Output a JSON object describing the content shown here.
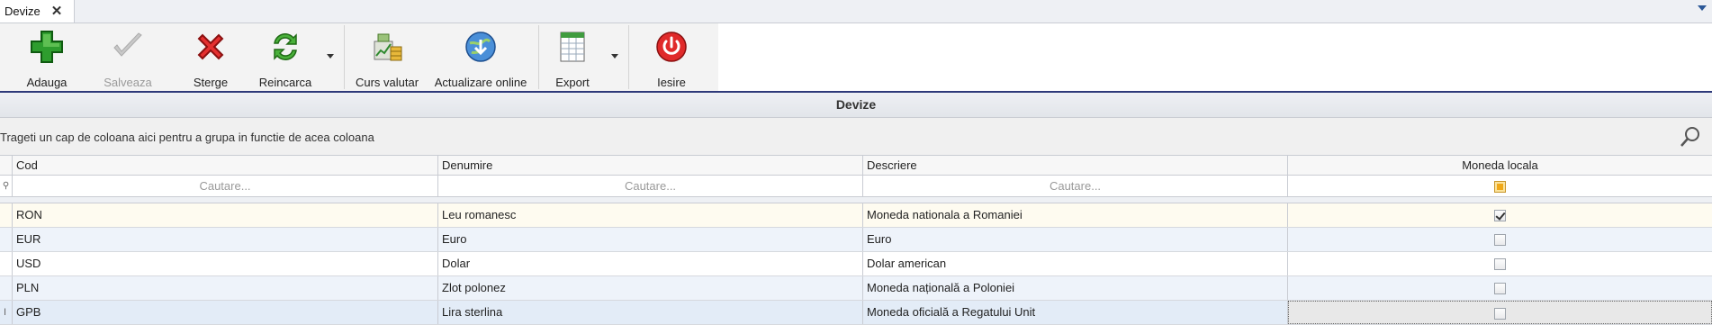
{
  "tab": {
    "title": "Devize",
    "close": "✕"
  },
  "toolbar": {
    "add": "Adauga",
    "save": "Salveaza",
    "delete": "Sterge",
    "reload": "Reincarca",
    "exchange": "Curs valutar",
    "online": "Actualizare online",
    "export": "Export",
    "exit": "Iesire"
  },
  "group_title": "Devize",
  "group_panel_text": "Trageti un cap de coloana aici pentru a grupa in functie de acea coloana",
  "columns": [
    "Cod",
    "Denumire",
    "Descriere",
    "Moneda locala"
  ],
  "filter_placeholder": "Cautare...",
  "rows": [
    {
      "cod": "RON",
      "denumire": "Leu romanesc",
      "descriere": "Moneda nationala a Romaniei",
      "local": true
    },
    {
      "cod": "EUR",
      "denumire": "Euro",
      "descriere": "Euro",
      "local": false
    },
    {
      "cod": "USD",
      "denumire": "Dolar",
      "descriere": "Dolar american",
      "local": false
    },
    {
      "cod": "PLN",
      "denumire": "Zlot polonez",
      "descriere": "Moneda națională a Poloniei",
      "local": false
    },
    {
      "cod": "GPB",
      "denumire": "Lira sterlina",
      "descriere": "Moneda oficială a Regatului Unit",
      "local": false
    }
  ],
  "colors": {
    "accent": "#2e3a7a",
    "row_alt": "#eef3fa",
    "row_first": "#fefbf0",
    "row_selected": "#e3ecf7"
  }
}
